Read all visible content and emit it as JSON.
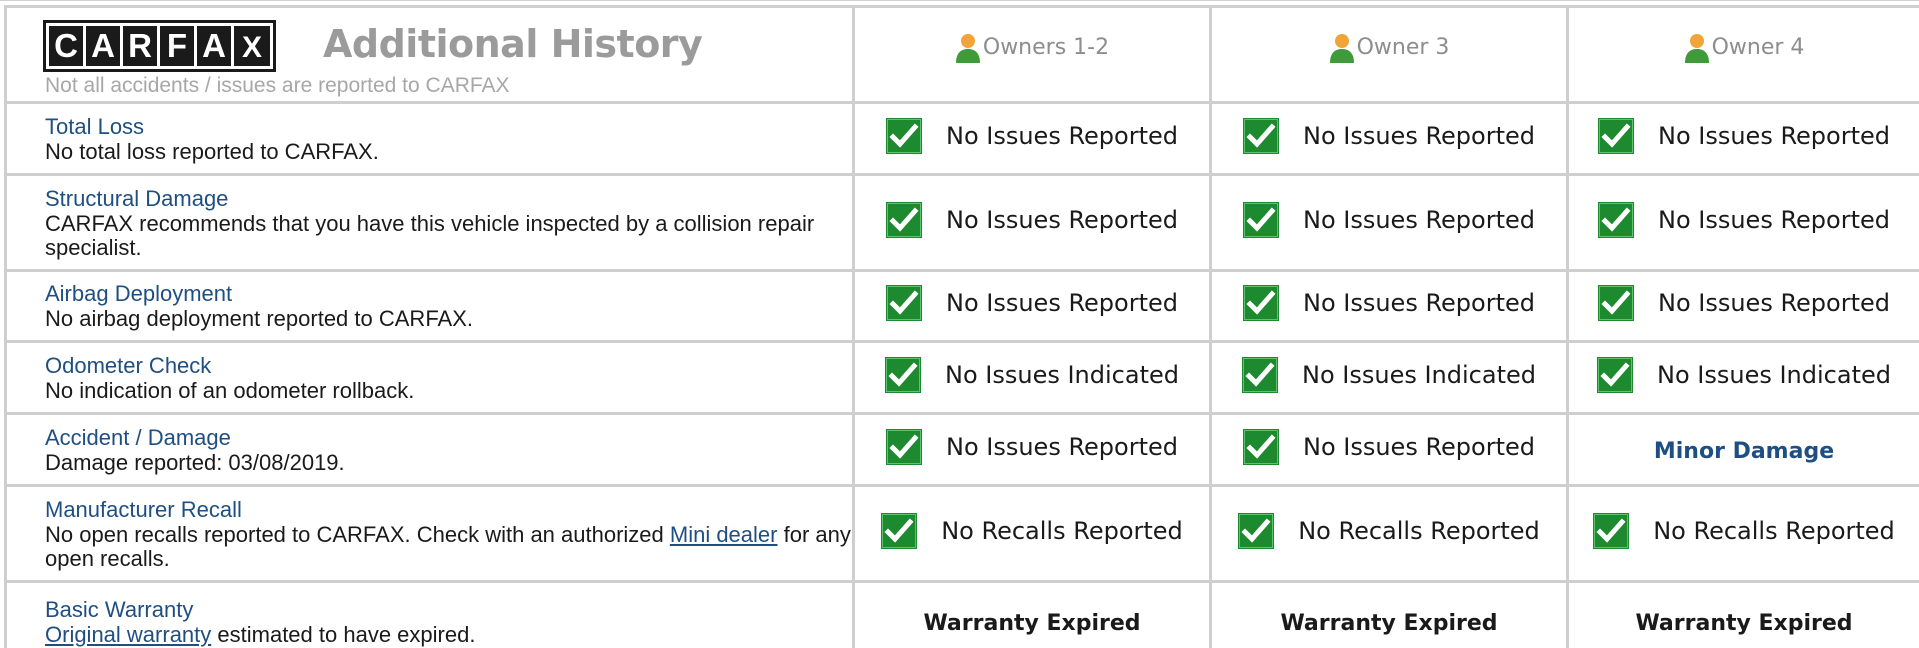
{
  "header": {
    "logo_letters": [
      "C",
      "A",
      "R",
      "F",
      "A",
      "X"
    ],
    "title": "Additional History",
    "subtitle": "Not all accidents / issues are reported to CARFAX",
    "owners": [
      "Owners 1-2",
      "Owner 3",
      "Owner 4"
    ],
    "owner_icon": "person-icon"
  },
  "colors": {
    "link_blue": "#1f4f82",
    "check_green": "#1d8a2f",
    "grid_border": "#cfcfcf",
    "header_gray": "#8d8d8d"
  },
  "rows": [
    {
      "title": "Total Loss",
      "desc": "No total loss reported to CARFAX.",
      "statuses": [
        "No Issues Reported",
        "No Issues Reported",
        "No Issues Reported"
      ]
    },
    {
      "title": "Structural Damage",
      "desc": "CARFAX recommends that you have this vehicle inspected by a collision repair specialist.",
      "statuses": [
        "No Issues Reported",
        "No Issues Reported",
        "No Issues Reported"
      ]
    },
    {
      "title": "Airbag Deployment",
      "desc": "No airbag deployment reported to CARFAX.",
      "statuses": [
        "No Issues Reported",
        "No Issues Reported",
        "No Issues Reported"
      ]
    },
    {
      "title": "Odometer Check",
      "desc": "No indication of an odometer rollback.",
      "statuses": [
        "No Issues Indicated",
        "No Issues Indicated",
        "No Issues Indicated"
      ]
    },
    {
      "title": "Accident / Damage",
      "desc": "Damage reported: 03/08/2019.",
      "statuses": [
        "No Issues Reported",
        "No Issues Reported"
      ],
      "status_owner4": "Minor Damage"
    },
    {
      "title": "Manufacturer Recall",
      "desc_before": "No open recalls reported to CARFAX. Check with an authorized ",
      "desc_link": "Mini dealer",
      "desc_after": " for any open recalls.",
      "statuses": [
        "No Recalls Reported",
        "No Recalls Reported",
        "No Recalls Reported"
      ]
    },
    {
      "title": "Basic Warranty",
      "desc_link": "Original warranty",
      "desc_after": " estimated to have expired.",
      "statuses": [
        "Warranty Expired",
        "Warranty Expired",
        "Warranty Expired"
      ]
    }
  ],
  "icons": {
    "check": "check-icon",
    "owner": "person-icon"
  }
}
